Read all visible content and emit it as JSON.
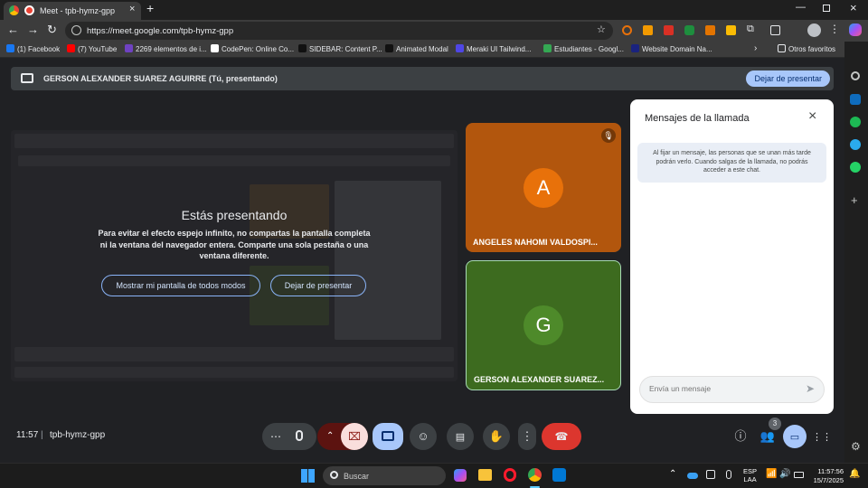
{
  "browser": {
    "tab_title": "Meet - tpb-hymz-gpp",
    "url": "https://meet.google.com/tpb-hymz-gpp",
    "bookmarks": [
      {
        "label": "(1) Facebook",
        "color": "#1877f2"
      },
      {
        "label": "(7) YouTube",
        "color": "#ff0000"
      },
      {
        "label": "2269 elementos de i...",
        "color": "#6f42c1"
      },
      {
        "label": "CodePen: Online Co...",
        "color": "#ffffff"
      },
      {
        "label": "SIDEBAR: Content P...",
        "color": "#111111"
      },
      {
        "label": "Animated Modal",
        "color": "#111111"
      },
      {
        "label": "Meraki UI Tailwind...",
        "color": "#4f46e5"
      },
      {
        "label": "Estudiantes - Googl...",
        "color": "#34a853"
      },
      {
        "label": "Website Domain Na...",
        "color": "#1a237e"
      }
    ],
    "other_bookmarks": "Otros favoritos"
  },
  "meet": {
    "presenter_bar": {
      "title": "GERSON ALEXANDER SUAREZ AGUIRRE (Tú, presentando)",
      "stop_label": "Dejar de presentar"
    },
    "overlay": {
      "title": "Estás presentando",
      "text": "Para evitar el efecto espejo infinito, no compartas la pantalla completa ni la ventana del navegador entera. Comparte una sola pestaña o una ventana diferente.",
      "show_anyway_label": "Mostrar mi pantalla de todos modos",
      "stop_label": "Dejar de presentar"
    },
    "participants": [
      {
        "initial": "A",
        "name": "ANGELES NAHOMI VALDOSPI...",
        "tile_color": "#b2560d",
        "avatar_color": "#e8710a",
        "muted": true
      },
      {
        "initial": "G",
        "name": "GERSON ALEXANDER SUAREZ...",
        "tile_color": "#3d6b1f",
        "avatar_color": "#4e8a2a",
        "muted": false
      }
    ],
    "chat": {
      "title": "Mensajes de la llamada",
      "note": "Al fijar un mensaje, las personas que se unan más tarde podrán verlo. Cuando salgas de la llamada, no podrás acceder a este chat.",
      "input_placeholder": "Envía un mensaje"
    },
    "footer": {
      "time": "11:57",
      "meeting_code": "tpb-hymz-gpp",
      "people_count": "3"
    }
  },
  "taskbar": {
    "search_placeholder": "Buscar",
    "language": "ESP",
    "layout": "LAA",
    "clock_time": "11:57:56",
    "clock_date": "15/7/2025"
  }
}
